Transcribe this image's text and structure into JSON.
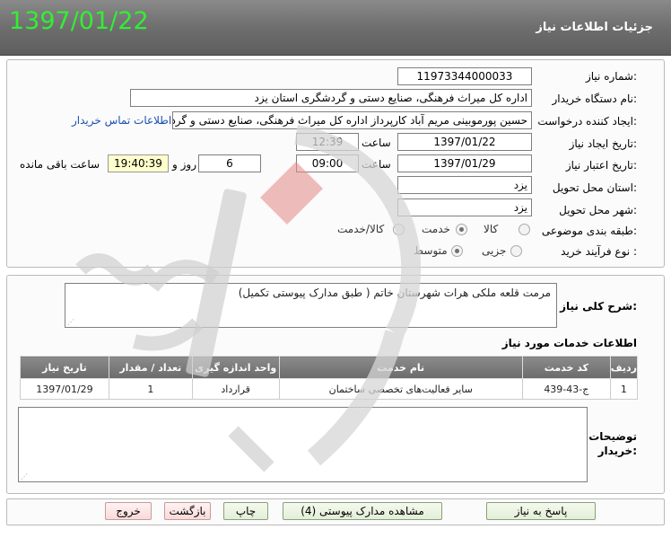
{
  "header": {
    "date": "1397/01/22",
    "title": "جزئیات اطلاعات نیاز"
  },
  "form": {
    "need_number_label": "شماره نیاز:",
    "need_number": "11973344000033",
    "buyer_org_label": "نام دستگاه خریدار:",
    "buyer_org": "اداره کل میراث فرهنگی، صنایع دستی و گردشگری استان یزد",
    "requester_label": "ایجاد کننده درخواست:",
    "requester": "حسین پورموبینی مریم آباد کارپرداز اداره کل میراث فرهنگی، صنایع دستی و گردشگری",
    "contact_link": "اطلاعات تماس خریدار",
    "created_label": "تاریخ ایجاد نیاز:",
    "created_date": "1397/01/22",
    "hour_label": "ساعت",
    "created_time": "12:39",
    "validity_label": "تاریخ اعتبار نیاز:",
    "validity_date": "1397/01/29",
    "validity_time": "09:00",
    "days_value": "6",
    "days_label": "روز و",
    "remaining_time": "19:40:39",
    "remaining_label": "ساعت باقی مانده",
    "province_label": "استان محل تحویل:",
    "province": "یزد",
    "city_label": "شهر محل تحویل:",
    "city": "یزد",
    "category_label": "طبقه بندی موضوعی:",
    "category_options": [
      "کالا",
      "خدمت",
      "کالا/خدمت"
    ],
    "category_selected": "خدمت",
    "process_label": "نوع فرآیند خرید :",
    "process_options": [
      "جزیی",
      "متوسط"
    ],
    "process_selected": "متوسط"
  },
  "details": {
    "summary_label": "شرح کلی نیاز:",
    "summary_text": "مرمت قلعه ملکی هرات شهرستان خاتم ( طبق مدارک پیوستی تکمیل)",
    "services_title": "اطلاعات خدمات مورد نیاز",
    "table": {
      "headers": [
        "ردیف",
        "کد خدمت",
        "نام خدمت",
        "واحد اندازه گیری",
        "تعداد / مقدار",
        "تاریخ نیاز"
      ],
      "rows": [
        [
          "1",
          "ج-43-439",
          "سایر فعالیت‌های تخصصی ساختمان",
          "قرارداد",
          "1",
          "1397/01/29"
        ]
      ]
    },
    "buyer_notes_label": "توضیحات خریدار:"
  },
  "buttons": {
    "reply": "پاسخ به نیاز",
    "attachments": "مشاهده مدارک پیوستی (4)",
    "print": "چاپ",
    "back": "بازگشت",
    "exit": "خروج"
  },
  "colors": {
    "header_date": "#33ee33",
    "remaining_bg": "#ffffcc",
    "link": "#1a4fb3"
  }
}
